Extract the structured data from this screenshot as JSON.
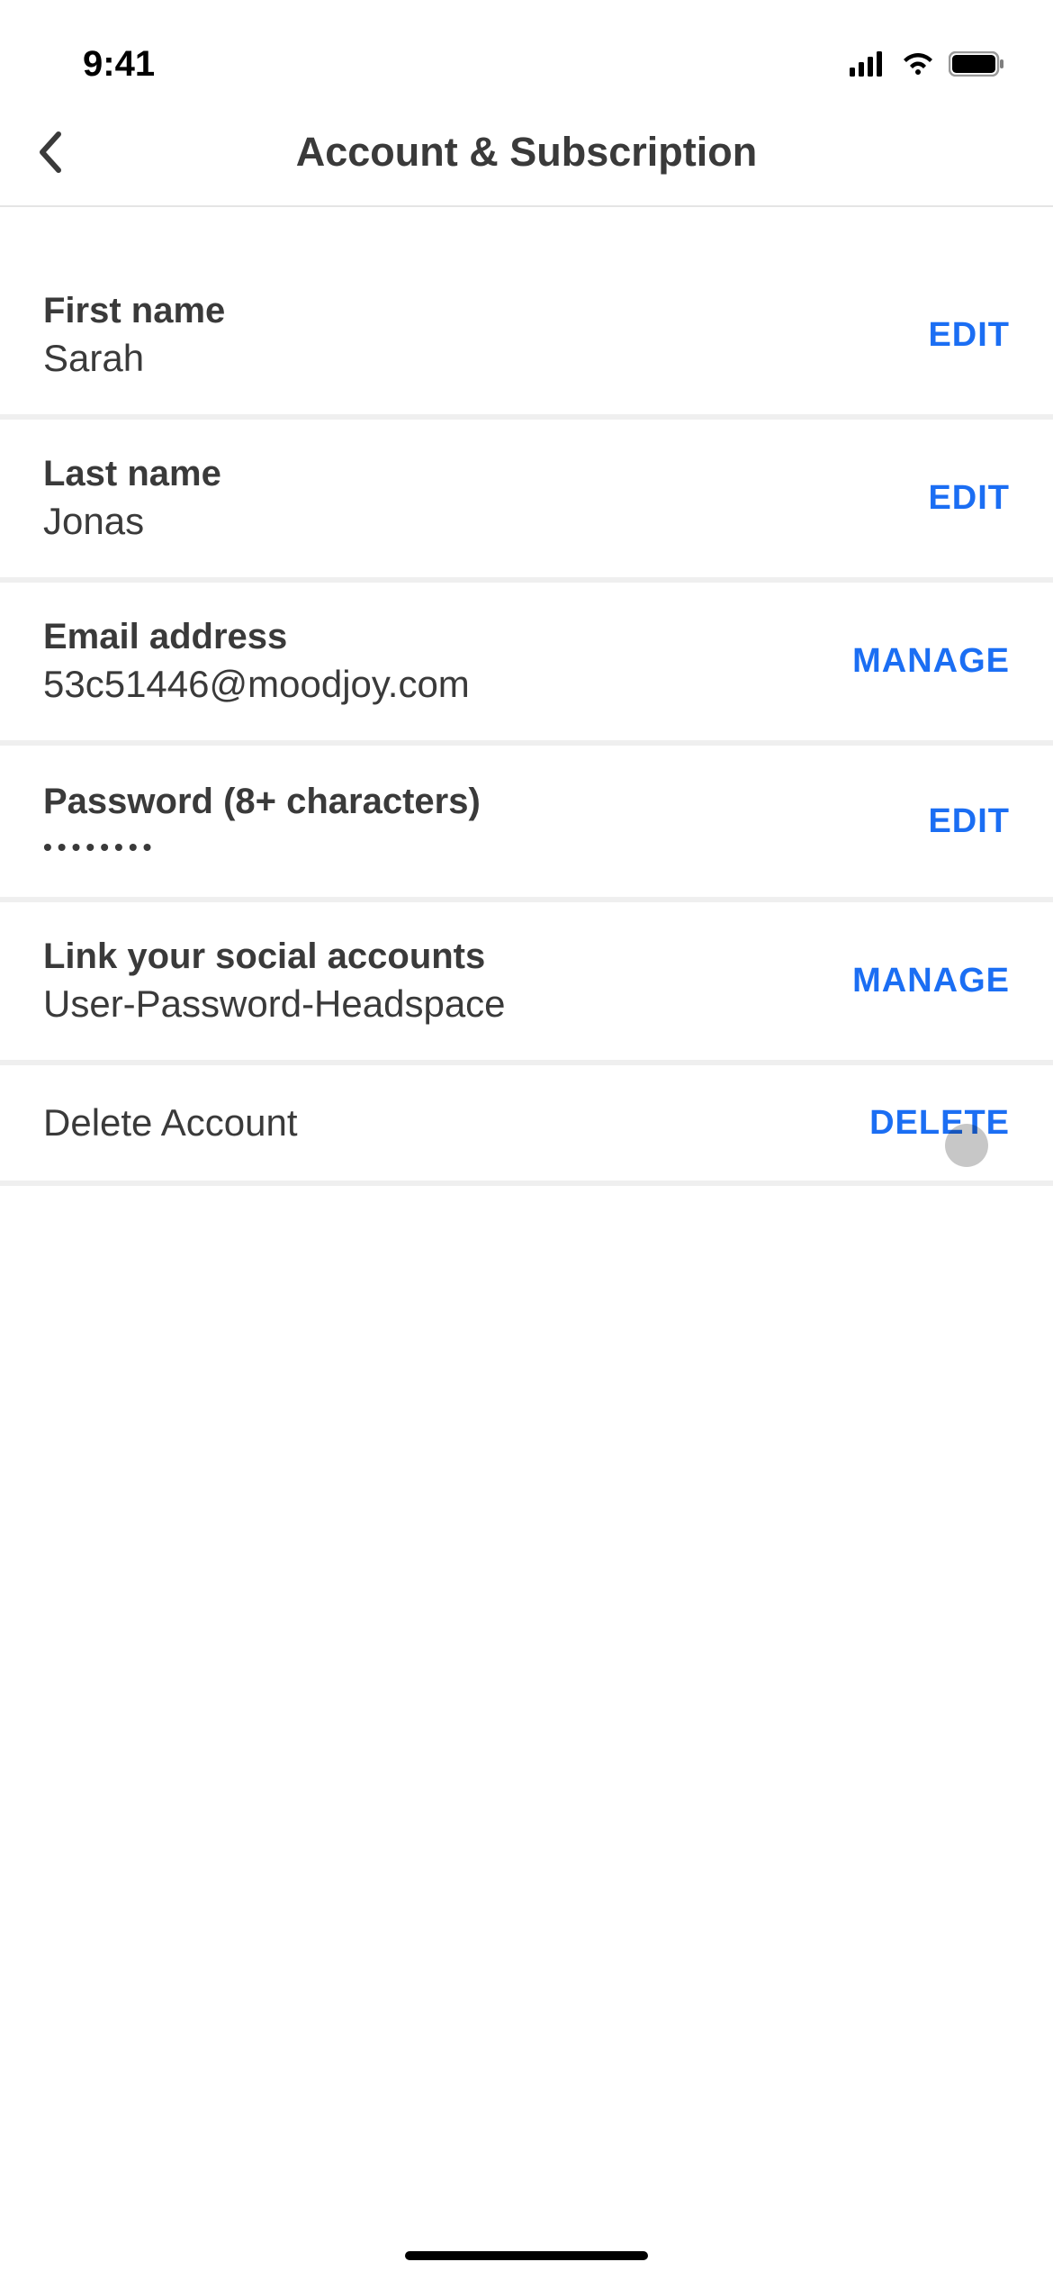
{
  "status": {
    "time": "9:41"
  },
  "header": {
    "title": "Account & Subscription"
  },
  "rows": {
    "firstName": {
      "label": "First name",
      "value": "Sarah",
      "action": "EDIT"
    },
    "lastName": {
      "label": "Last name",
      "value": "Jonas",
      "action": "EDIT"
    },
    "email": {
      "label": "Email address",
      "value": "53c51446@moodjoy.com",
      "action": "MANAGE"
    },
    "password": {
      "label": "Password (8+ characters)",
      "value": "••••••••",
      "action": "EDIT"
    },
    "social": {
      "label": "Link your social accounts",
      "value": "User-Password-Headspace",
      "action": "MANAGE"
    },
    "delete": {
      "label": "Delete Account",
      "action": "DELETE"
    }
  },
  "colors": {
    "accent": "#1b6ef3",
    "textPrimary": "#3a3a3a",
    "separator": "#efefef"
  }
}
